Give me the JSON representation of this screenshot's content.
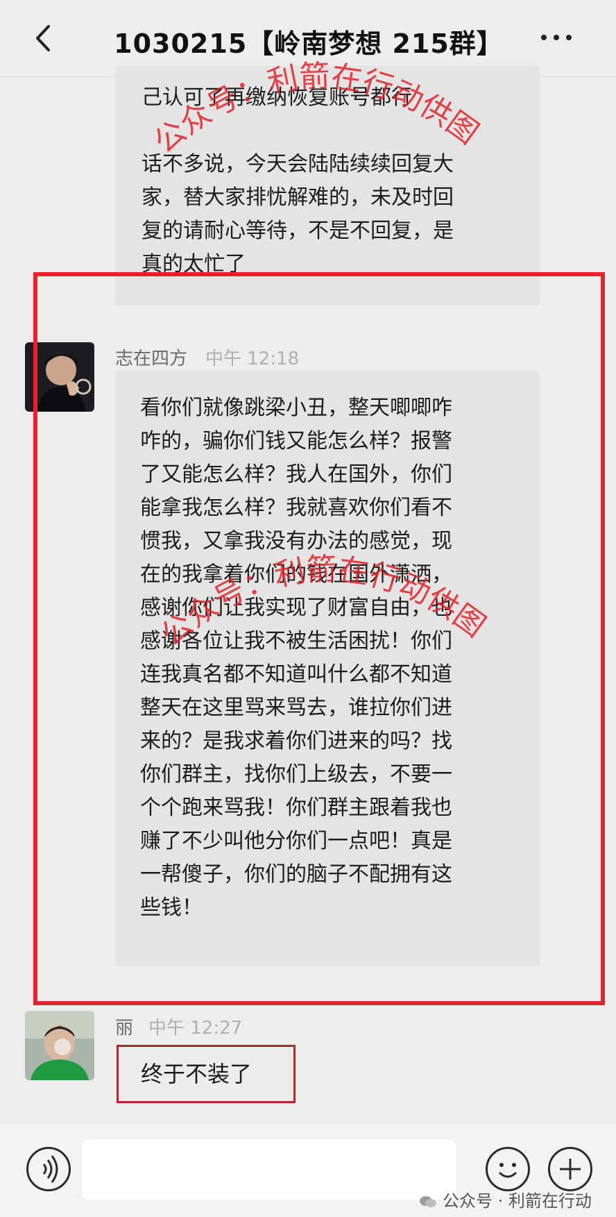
{
  "header": {
    "title": "1030215【岭南梦想 215群】"
  },
  "messages": [
    {
      "lines": [
        "己认可了再缴纳恢复账号都行",
        "",
        "话不多说，今天会陆陆续续回复大",
        "家，替大家排忧解难的，未及时回",
        "复的请耐心等待，不是不回复，是",
        "真的太忙了"
      ]
    },
    {
      "sender": "志在四方",
      "time": "中午 12:18",
      "lines": [
        "看你们就像跳梁小丑，整天唧唧咋",
        "咋的，骗你们钱又能怎么样？报警",
        "了又能怎么样？我人在国外，你们",
        "能拿我怎么样？我就喜欢你们看不",
        "惯我，又拿我没有办法的感觉，现",
        "在的我拿着你们的钱在国外潇洒，",
        "感谢你们让我实现了财富自由，也",
        "感谢各位让我不被生活困扰！你们",
        "连我真名都不知道叫什么都不知道",
        "整天在这里骂来骂去，谁拉你们进",
        "来的？是我求着你们进来的吗？找",
        "你们群主，找你们上级去，不要一",
        "个个跑来骂我！你们群主跟着我也",
        "赚了不少叫他分你们一点吧！真是",
        "一帮傻子，你们的脑子不配拥有这",
        "些钱！"
      ]
    },
    {
      "sender": "丽",
      "time": "中午 12:27",
      "text": "终于不装了"
    }
  ],
  "watermark": {
    "stamp_text": "公众号：利箭在行动供图",
    "bottom_text": "公众号 · 利箭在行动"
  },
  "colors": {
    "highlight_frame": "#e0262c",
    "stamp": "#e0262c",
    "bubble": "#e4e4e4"
  },
  "icons": [
    "back-arrow-icon",
    "more-dots-icon",
    "voice-icon",
    "emoji-icon",
    "plus-icon",
    "wechat-logo-icon"
  ]
}
